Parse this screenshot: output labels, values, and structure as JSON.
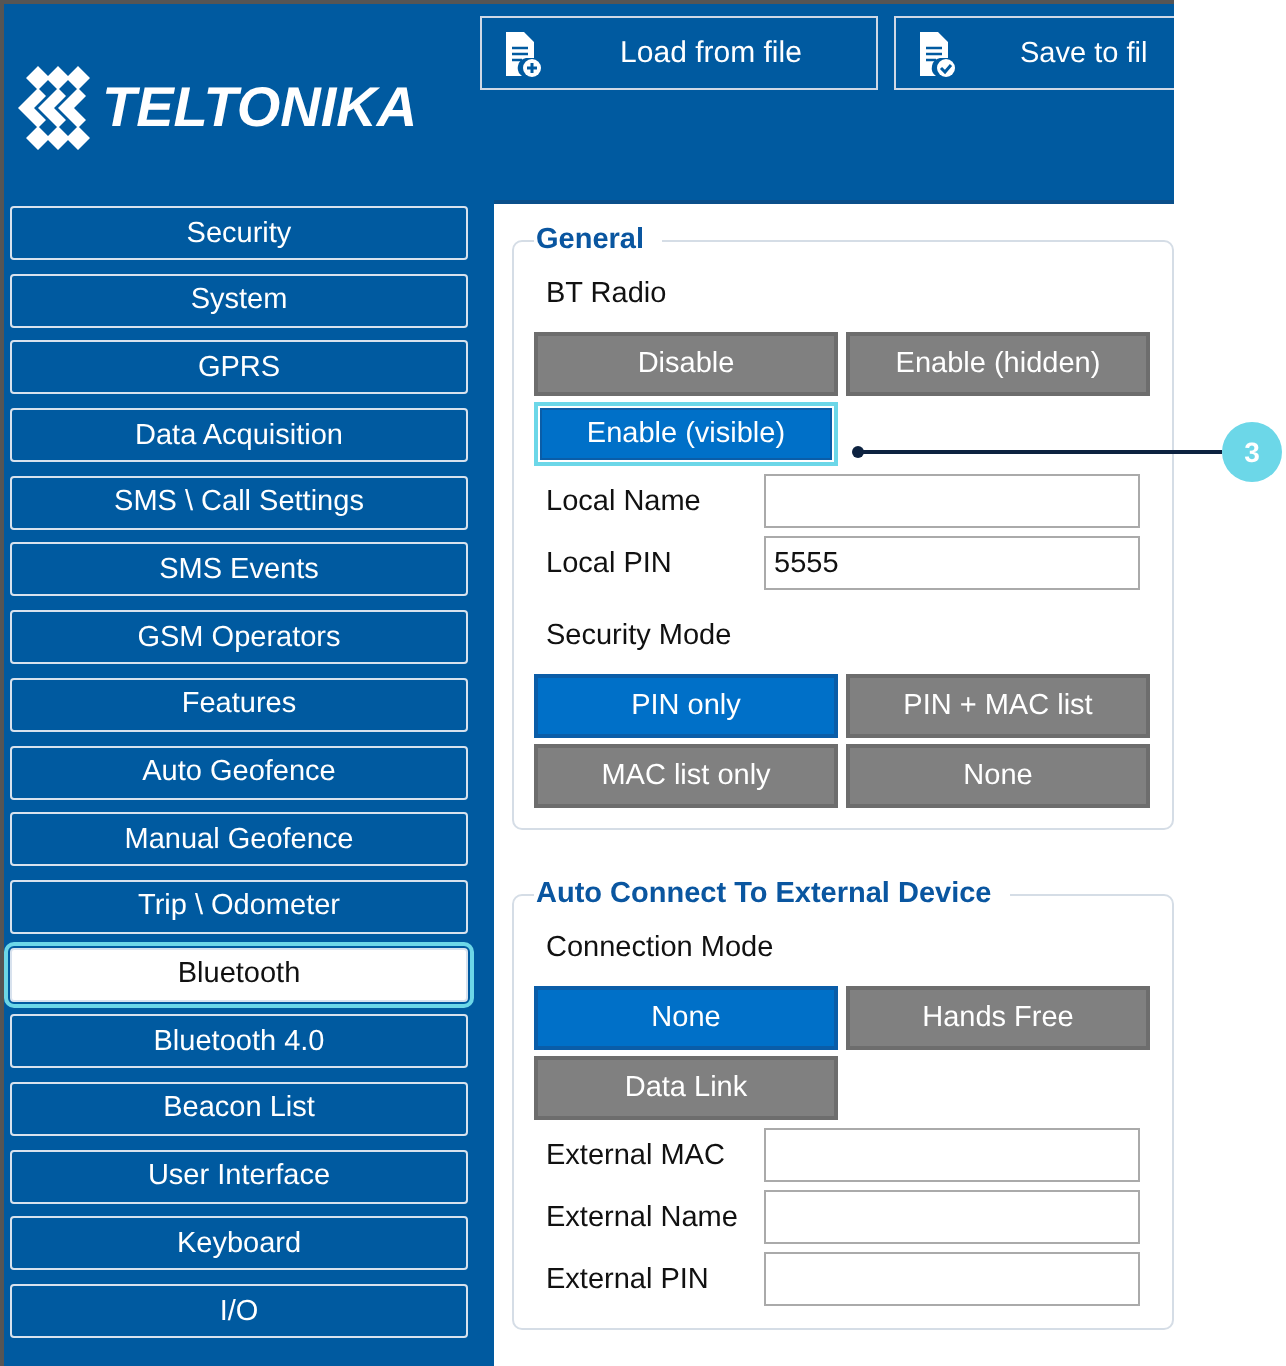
{
  "header": {
    "logo": "TELTONIKA",
    "buttons": [
      {
        "label": "Load from file",
        "kind": "load"
      },
      {
        "label": "Save to fil",
        "kind": "save"
      }
    ]
  },
  "sidebar": {
    "items": [
      {
        "label": "Security",
        "selected": false
      },
      {
        "label": "System",
        "selected": false
      },
      {
        "label": "GPRS",
        "selected": false
      },
      {
        "label": "Data Acquisition",
        "selected": false
      },
      {
        "label": "SMS \\ Call Settings",
        "selected": false
      },
      {
        "label": "SMS Events",
        "selected": false
      },
      {
        "label": "GSM Operators",
        "selected": false
      },
      {
        "label": "Features",
        "selected": false
      },
      {
        "label": "Auto Geofence",
        "selected": false
      },
      {
        "label": "Manual Geofence",
        "selected": false
      },
      {
        "label": "Trip \\ Odometer",
        "selected": false
      },
      {
        "label": "Bluetooth",
        "selected": true
      },
      {
        "label": "Bluetooth 4.0",
        "selected": false
      },
      {
        "label": "Beacon List",
        "selected": false
      },
      {
        "label": "User Interface",
        "selected": false
      },
      {
        "label": "Keyboard",
        "selected": false
      },
      {
        "label": "I/O",
        "selected": false
      }
    ]
  },
  "general": {
    "title": "General",
    "bt_radio": {
      "label": "BT Radio",
      "options": [
        {
          "label": "Disable",
          "selected": false,
          "focused": false
        },
        {
          "label": "Enable (hidden)",
          "selected": false,
          "focused": false
        },
        {
          "label": "Enable (visible)",
          "selected": true,
          "focused": true
        }
      ]
    },
    "fields": [
      {
        "label": "Local Name"
      },
      {
        "label": "Local PIN",
        "value": "5555"
      }
    ],
    "security_mode": {
      "label": "Security Mode",
      "options": [
        {
          "label": "PIN only",
          "selected": true
        },
        {
          "label": "PIN + MAC list",
          "selected": false
        },
        {
          "label": "MAC list only",
          "selected": false
        },
        {
          "label": "None",
          "selected": false
        }
      ]
    }
  },
  "auto_connect": {
    "title": "Auto Connect To External Device",
    "connection_mode": {
      "label": "Connection Mode",
      "options": [
        {
          "label": "None",
          "selected": true
        },
        {
          "label": "Hands Free",
          "selected": false
        },
        {
          "label": "Data Link",
          "selected": false
        }
      ]
    },
    "fields": [
      {
        "label": "External MAC"
      },
      {
        "label": "External Name"
      },
      {
        "label": "External PIN"
      }
    ]
  },
  "callout": {
    "label": "3"
  }
}
